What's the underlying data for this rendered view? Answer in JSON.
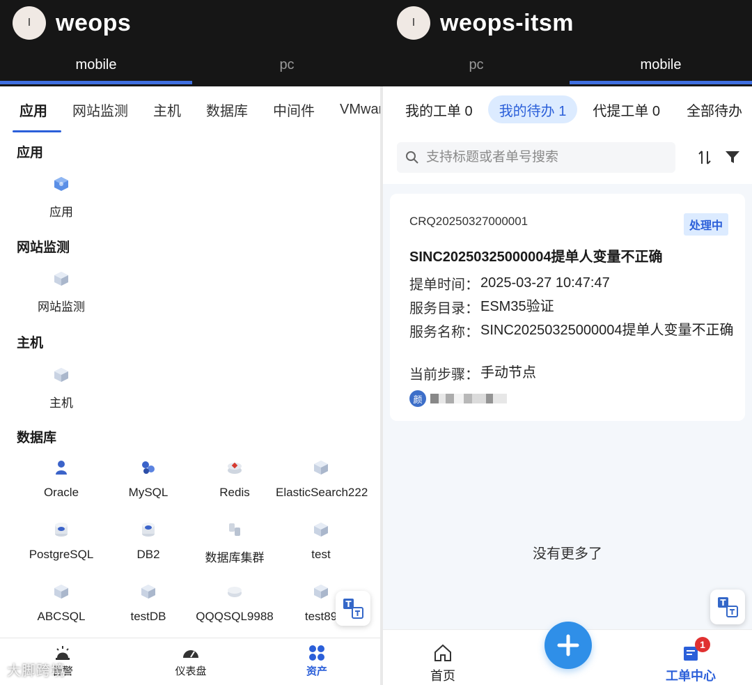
{
  "left_app": {
    "avatar_letter": "I",
    "title": "weops",
    "env_tabs": [
      "mobile",
      "pc"
    ],
    "active_env": "mobile",
    "category_tabs": [
      "应用",
      "网站监测",
      "主机",
      "数据库",
      "中间件",
      "VMware"
    ],
    "sections": [
      {
        "title": "应用",
        "items": [
          {
            "label": "应用",
            "icon": "app-cube-icon"
          }
        ]
      },
      {
        "title": "网站监测",
        "items": [
          {
            "label": "网站监测",
            "icon": "cube-icon"
          }
        ]
      },
      {
        "title": "主机",
        "items": [
          {
            "label": "主机",
            "icon": "cube-icon"
          }
        ]
      },
      {
        "title": "数据库",
        "items": [
          {
            "label": "Oracle",
            "icon": "oracle-icon"
          },
          {
            "label": "MySQL",
            "icon": "mysql-icon"
          },
          {
            "label": "Redis",
            "icon": "redis-icon"
          },
          {
            "label": "ElasticSearch222",
            "icon": "cube-icon"
          },
          {
            "label": "PostgreSQL",
            "icon": "database-icon"
          },
          {
            "label": "DB2",
            "icon": "database-icon"
          },
          {
            "label": "数据库集群",
            "icon": "cluster-icon"
          },
          {
            "label": "test",
            "icon": "cube-icon"
          },
          {
            "label": "ABCSQL",
            "icon": "cube-icon"
          },
          {
            "label": "testDB",
            "icon": "cube-icon"
          },
          {
            "label": "QQQSQL9988",
            "icon": "cube-icon"
          },
          {
            "label": "test89",
            "icon": "cube-icon"
          }
        ]
      }
    ],
    "bottom_nav": [
      {
        "label": "告警",
        "icon": "alarm-icon"
      },
      {
        "label": "仪表盘",
        "icon": "dashboard-icon"
      },
      {
        "label": "资产",
        "icon": "assets-icon",
        "active": true
      }
    ],
    "watermark": "大脚跨境"
  },
  "right_app": {
    "avatar_letter": "I",
    "title": "weops-itsm",
    "env_tabs": [
      "pc",
      "mobile"
    ],
    "active_env": "mobile",
    "ticket_tabs": [
      "我的工单 0",
      "我的待办 1",
      "代提工单 0",
      "全部待办"
    ],
    "active_ticket_tab": "我的待办 1",
    "search": {
      "placeholder": "支持标题或者单号搜索",
      "value": ""
    },
    "ticket": {
      "order_no": "CRQ20250327000001",
      "status": "处理中",
      "title": "SINC20250325000004提单人变量不正确",
      "fields": [
        {
          "key": "提单时间：",
          "value": "2025-03-27 10:47:47"
        },
        {
          "key": "服务目录：",
          "value": "ESM35验证"
        },
        {
          "key": "服务名称：",
          "value": "SINC20250325000004提单人变量不正确"
        },
        {
          "key": "当前步骤：",
          "value": "手动节点"
        }
      ],
      "assignee_badge": "颜"
    },
    "no_more_text": "没有更多了",
    "bottom_nav": [
      {
        "label": "首页",
        "icon": "home-icon"
      },
      {
        "label": "工单中心",
        "icon": "ticket-center-icon",
        "active": true,
        "badge": "1"
      }
    ]
  },
  "colors": {
    "accent": "#2b5fd9",
    "fab": "#2f8fe8",
    "header_bg": "#161616",
    "status_bg": "#dcebff",
    "notif": "#e03131"
  }
}
